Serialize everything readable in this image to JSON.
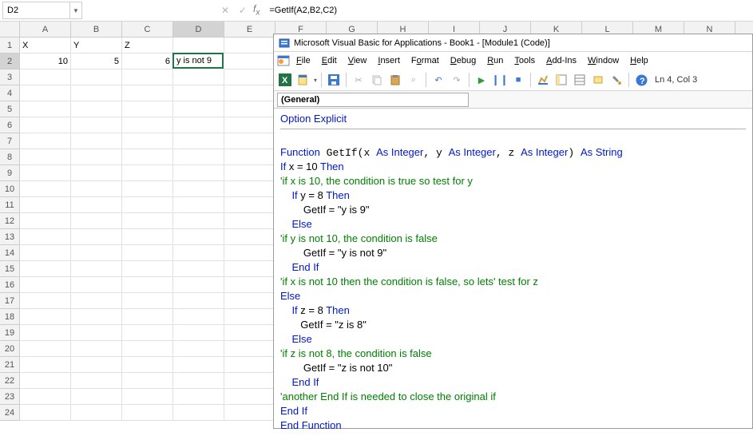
{
  "formula_bar": {
    "name_box": "D2",
    "formula": "=GetIf(A2,B2,C2)"
  },
  "grid": {
    "columns": [
      "A",
      "B",
      "C",
      "D",
      "E",
      "F",
      "G",
      "H",
      "I",
      "J",
      "K",
      "L",
      "M",
      "N"
    ],
    "rows": 24,
    "cells": {
      "A1": "X",
      "B1": "Y",
      "C1": "Z",
      "A2": "10",
      "B2": "5",
      "C2": "6",
      "D2": "y is not 9"
    },
    "selected": "D2"
  },
  "vbe": {
    "title": "Microsoft Visual Basic for Applications - Book1 - [Module1 (Code)]",
    "menu": [
      "File",
      "Edit",
      "View",
      "Insert",
      "Format",
      "Debug",
      "Run",
      "Tools",
      "Add-Ins",
      "Window",
      "Help"
    ],
    "cursor": "Ln 4, Col 3",
    "combo": "(General)",
    "code": {
      "l0": "Option Explicit",
      "l1": "Function GetIf(x As Integer, y As Integer, z As Integer) As String",
      "l2": "If",
      "l2b": " x = 10 ",
      "l2c": "Then",
      "l3": "'if x is 10, the condition is true so test for y",
      "l4a": "    If",
      "l4b": " y = 8 ",
      "l4c": "Then",
      "l5": "        GetIf = \"y is 9\"",
      "l6": "    Else",
      "l7": "'if y is not 10, the condition is false",
      "l8": "        GetIf = \"y is not 9\"",
      "l9": "    End If",
      "l10": "'if x is not 10 then the condition is false, so lets' test for z",
      "l11": "Else",
      "l12a": "    If",
      "l12b": " z = 8 ",
      "l12c": "Then",
      "l13": "       GetIf = \"z is 8\"",
      "l14": "    Else",
      "l15": "'if z is not 8, the condition is false",
      "l16": "        GetIf = \"z is not 10\"",
      "l17": "    End If",
      "l18": "'another End If is needed to close the original if",
      "l19": "End If",
      "l20": "End Function"
    }
  }
}
